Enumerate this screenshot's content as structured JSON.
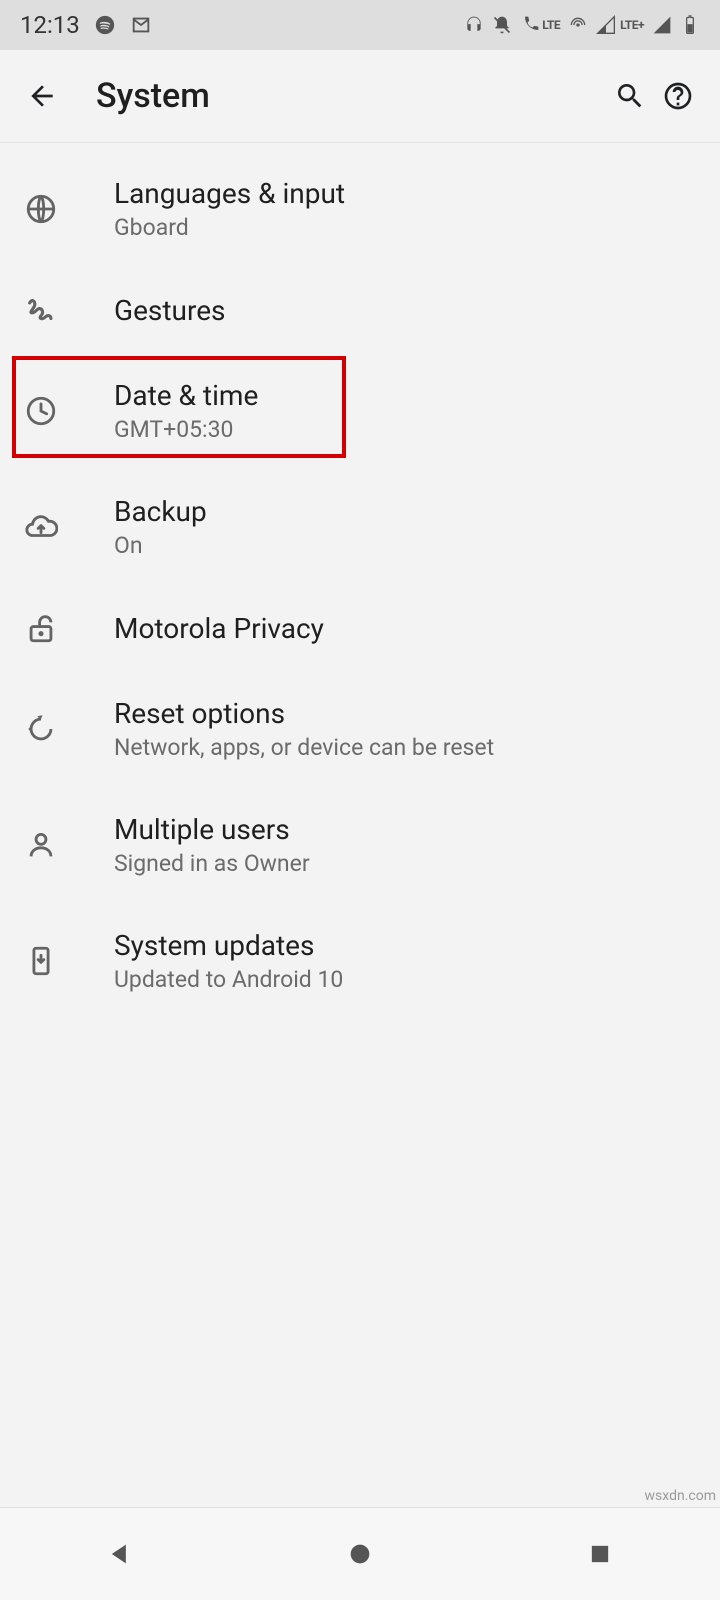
{
  "statusbar": {
    "time": "12:13",
    "lte": "LTE"
  },
  "appbar": {
    "title": "System"
  },
  "items": [
    {
      "name": "languages-input",
      "title": "Languages & input",
      "sub": "Gboard"
    },
    {
      "name": "gestures",
      "title": "Gestures",
      "sub": ""
    },
    {
      "name": "date-time",
      "title": "Date & time",
      "sub": "GMT+05:30"
    },
    {
      "name": "backup",
      "title": "Backup",
      "sub": "On"
    },
    {
      "name": "motorola-privacy",
      "title": "Motorola Privacy",
      "sub": ""
    },
    {
      "name": "reset-options",
      "title": "Reset options",
      "sub": "Network, apps, or device can be reset"
    },
    {
      "name": "multiple-users",
      "title": "Multiple users",
      "sub": "Signed in as Owner"
    },
    {
      "name": "system-updates",
      "title": "System updates",
      "sub": "Updated to Android 10"
    }
  ],
  "watermark": "wsxdn.com"
}
